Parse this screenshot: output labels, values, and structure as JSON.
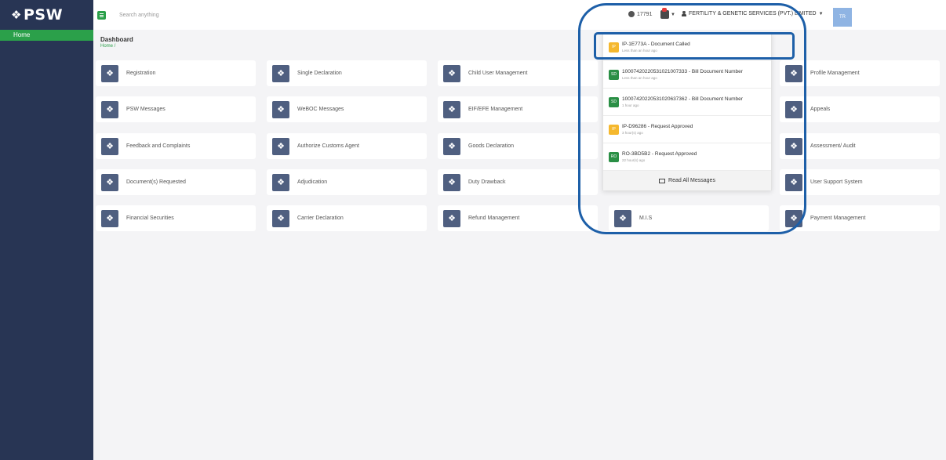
{
  "brand": {
    "logo_mark": "❖",
    "name": "PSW"
  },
  "sidebar": {
    "items": [
      {
        "label": "Home"
      }
    ]
  },
  "topbar": {
    "search_placeholder": "Search anything",
    "counter": "17791",
    "company": "FERTILITY & GENETIC SERVICES (PVT.) LIMITED",
    "avatar_initials": "TR"
  },
  "page": {
    "title": "Dashboard",
    "breadcrumb": "Home /"
  },
  "tiles": [
    [
      "Registration",
      "Single Declaration",
      "Child User Management",
      "",
      "Profile Management"
    ],
    [
      "PSW Messages",
      "WeBOC Messages",
      "EIF/EFE Management",
      "",
      "Appeals"
    ],
    [
      "Feedback and Complaints",
      "Authorize Customs Agent",
      "Goods Declaration",
      "",
      "Assessment/ Audit"
    ],
    [
      "Document(s) Requested",
      "Adjudication",
      "Duty Drawback",
      "",
      "User Support System"
    ],
    [
      "Financial Securities",
      "Carrier Declaration",
      "Refund Management",
      "M.I.S",
      "Payment Management"
    ]
  ],
  "notifications": {
    "items": [
      {
        "badge": "IP",
        "color": "#f5b82e",
        "title": "IP-1E773A - Document Called",
        "time": "Less than an hour ago"
      },
      {
        "badge": "SD",
        "color": "#2a8f45",
        "title": "10007420220531021007333 - Bill Document Number",
        "time": "Less than an hour ago"
      },
      {
        "badge": "SD",
        "color": "#2a8f45",
        "title": "10007420220531020637362 - Bill Document Number",
        "time": "1 hour ago"
      },
      {
        "badge": "IP",
        "color": "#f5b82e",
        "title": "IP-D96286 - Request Approved",
        "time": "3 hour(s) ago"
      },
      {
        "badge": "RO",
        "color": "#2a8f45",
        "title": "RO-3BD5B2 - Request Approved",
        "time": "22 hour(s) ago"
      }
    ],
    "read_all": "Read All Messages"
  }
}
